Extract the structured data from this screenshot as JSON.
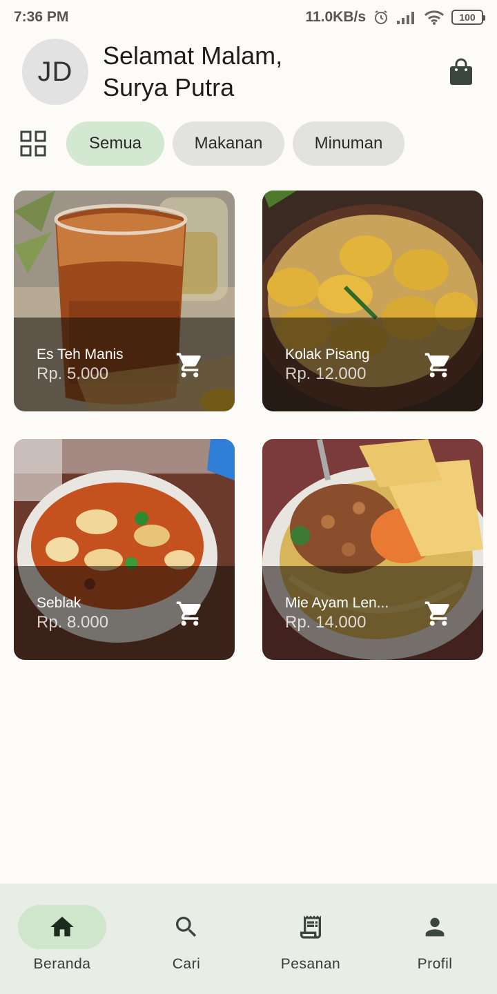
{
  "status_bar": {
    "time": "7:36 PM",
    "network_speed": "11.0KB/s",
    "battery": "100",
    "icons": [
      "alarm-icon",
      "signal-icon",
      "wifi-icon",
      "battery-icon"
    ]
  },
  "header": {
    "avatar_initials": "JD",
    "greeting_line1": "Selamat Malam,",
    "greeting_line2": "Surya Putra",
    "bag_icon": "shopping-bag-icon"
  },
  "filters": {
    "grid_icon": "grid-view-icon",
    "chips": [
      {
        "label": "Semua",
        "active": true
      },
      {
        "label": "Makanan",
        "active": false
      },
      {
        "label": "Minuman",
        "active": false
      }
    ]
  },
  "products": [
    {
      "name": "Es Teh Manis",
      "price": "Rp. 5.000",
      "image": "iced-tea"
    },
    {
      "name": "Kolak Pisang",
      "price": "Rp. 12.000",
      "image": "banana-compote"
    },
    {
      "name": "Seblak",
      "price": "Rp. 8.000",
      "image": "seblak-bowl"
    },
    {
      "name": "Mie Ayam Len...",
      "price": "Rp. 14.000",
      "image": "chicken-noodle-bowl"
    }
  ],
  "bottom_nav": [
    {
      "label": "Beranda",
      "icon": "home-icon",
      "active": true
    },
    {
      "label": "Cari",
      "icon": "search-icon",
      "active": false
    },
    {
      "label": "Pesanan",
      "icon": "receipt-icon",
      "active": false
    },
    {
      "label": "Profil",
      "icon": "person-icon",
      "active": false
    }
  ],
  "colors": {
    "background": "#fdfbf7",
    "chip_active": "#d3e8d0",
    "chip_inactive": "#e2e2e0",
    "nav_background": "#e8ede6",
    "nav_active": "#cfe5cc"
  }
}
